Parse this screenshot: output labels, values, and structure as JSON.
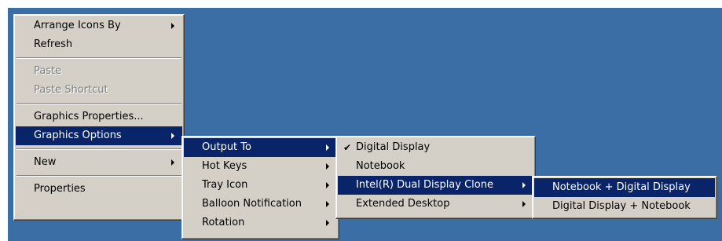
{
  "main_menu": {
    "items": [
      {
        "label": "Arrange Icons By"
      },
      {
        "label": "Refresh"
      },
      {
        "label": "Paste"
      },
      {
        "label": "Paste Shortcut"
      },
      {
        "label": "Graphics Properties..."
      },
      {
        "label": "Graphics Options"
      },
      {
        "label": "New"
      },
      {
        "label": "Properties"
      }
    ]
  },
  "graphics_options_menu": {
    "items": [
      {
        "label": "Output To"
      },
      {
        "label": "Hot Keys"
      },
      {
        "label": "Tray Icon"
      },
      {
        "label": "Balloon Notification"
      },
      {
        "label": "Rotation"
      }
    ]
  },
  "output_to_menu": {
    "items": [
      {
        "label": "Digital Display",
        "checked": true
      },
      {
        "label": "Notebook"
      },
      {
        "label": "Intel(R) Dual Display Clone"
      },
      {
        "label": "Extended Desktop"
      }
    ]
  },
  "clone_menu": {
    "items": [
      {
        "label": "Notebook + Digital Display"
      },
      {
        "label": "Digital Display + Notebook"
      }
    ]
  },
  "icons": {
    "check": "✔"
  },
  "colors": {
    "desktop": "#3a6ea5",
    "menu_face": "#d4d0c8",
    "highlight": "#0a246a",
    "disabled_text": "#808080"
  }
}
